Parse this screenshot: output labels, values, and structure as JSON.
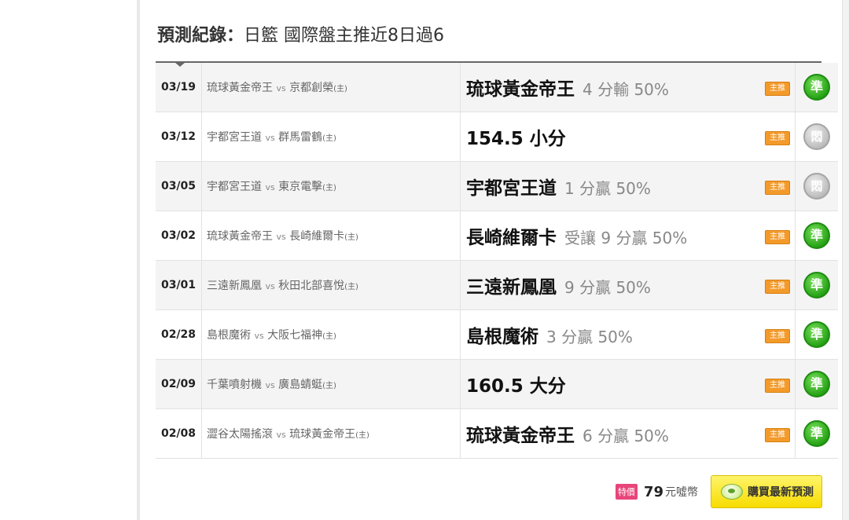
{
  "section": {
    "title_prefix": "預測紀錄：",
    "title_suffix": "日籃 國際盤主推近8日過6"
  },
  "records": [
    {
      "date": "03/19",
      "away": "琉球黃金帝王",
      "vs": "vs",
      "home": "京都創榮",
      "host_mark": "(主)",
      "pick": "琉球黃金帝王",
      "detail": "4 分輸 50%",
      "tag": "主推",
      "result": "準",
      "result_type": "hit"
    },
    {
      "date": "03/12",
      "away": "宇都宮王道",
      "vs": "vs",
      "home": "群馬雷鶴",
      "host_mark": "(主)",
      "pick": "154.5 小分",
      "detail": "",
      "tag": "主推",
      "result": "悶",
      "result_type": "push"
    },
    {
      "date": "03/05",
      "away": "宇都宮王道",
      "vs": "vs",
      "home": "東京電擊",
      "host_mark": "(主)",
      "pick": "宇都宮王道",
      "detail": "1 分贏 50%",
      "tag": "主推",
      "result": "悶",
      "result_type": "push"
    },
    {
      "date": "03/02",
      "away": "琉球黃金帝王",
      "vs": "vs",
      "home": "長崎維爾卡",
      "host_mark": "(主)",
      "pick": "長崎維爾卡",
      "detail": "受讓 9 分贏 50%",
      "tag": "主推",
      "result": "準",
      "result_type": "hit"
    },
    {
      "date": "03/01",
      "away": "三遠新鳳凰",
      "vs": "vs",
      "home": "秋田北部喜悅",
      "host_mark": "(主)",
      "pick": "三遠新鳳凰",
      "detail": "9 分贏 50%",
      "tag": "主推",
      "result": "準",
      "result_type": "hit"
    },
    {
      "date": "02/28",
      "away": "島根魔術",
      "vs": "vs",
      "home": "大阪七福神",
      "host_mark": "(主)",
      "pick": "島根魔術",
      "detail": "3 分贏 50%",
      "tag": "主推",
      "result": "準",
      "result_type": "hit"
    },
    {
      "date": "02/09",
      "away": "千葉噴射機",
      "vs": "vs",
      "home": "廣島蜻蜓",
      "host_mark": "(主)",
      "pick": "160.5 大分",
      "detail": "",
      "tag": "主推",
      "result": "準",
      "result_type": "hit"
    },
    {
      "date": "02/08",
      "away": "澀谷太陽搖滾",
      "vs": "vs",
      "home": "琉球黃金帝王",
      "host_mark": "(主)",
      "pick": "琉球黃金帝王",
      "detail": "6 分贏 50%",
      "tag": "主推",
      "result": "準",
      "result_type": "hit"
    }
  ],
  "purchase": {
    "special_tag": "特價",
    "price": "79",
    "unit": "元噓幣",
    "button_label": "購買最新預測"
  },
  "colors": {
    "tag_orange": "#f39a2a",
    "hit_green": "#27a316",
    "push_gray": "#bdbdbd",
    "buy_yellow": "#f7dc00",
    "special_pink": "#e8457a"
  }
}
